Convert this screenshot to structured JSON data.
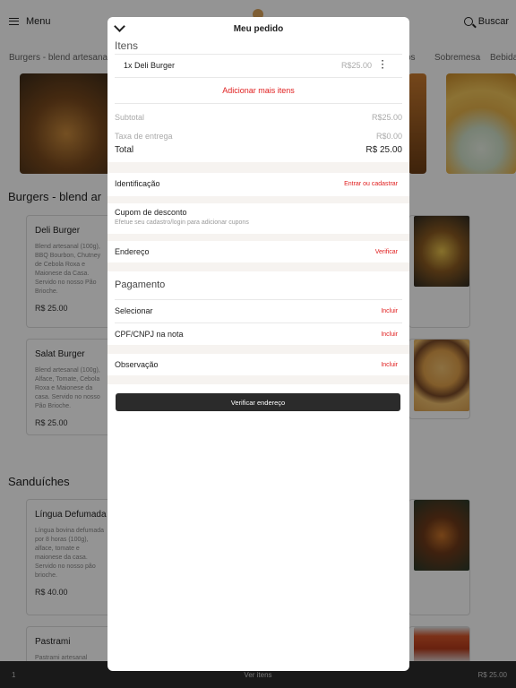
{
  "header": {
    "menu_label": "Menu",
    "search_label": "Buscar"
  },
  "categories": [
    "Burgers - blend artesanal",
    "os",
    "Sobremesa",
    "Bebida"
  ],
  "sections": [
    {
      "title": "Burgers - blend ar",
      "products": [
        {
          "name": "Deli Burger",
          "description": "Blend artesanal (100g), BBQ Bourbon, Chutney de Cebola Roxa e Maionese da Casa. Servido no nosso Pão Brioche.",
          "price": "R$ 25.00"
        },
        {
          "name": "Salat Burger",
          "description": "Blend artesanal (100g), Alface, Tomate, Cebola Roxa e Maionese da casa. Servido no nosso Pão Brioche.",
          "price": "R$ 25.00"
        }
      ]
    },
    {
      "title": "Sanduíches",
      "products": [
        {
          "name": "Língua Defumada",
          "description": "Língua bovina defumada por 8 horas (100g), alface, tomate e maionese da casa. Servido no nosso pão brioche.",
          "price": "R$ 40.00"
        },
        {
          "name": "Pastrami",
          "description": "Pastrami artesanal",
          "price": ""
        }
      ]
    }
  ],
  "bottom_bar": {
    "count": "1",
    "view_items": "Ver itens",
    "total": "R$ 25.00"
  },
  "modal": {
    "title": "Meu pedido",
    "items_heading": "Itens",
    "items": [
      {
        "name": "1x Deli Burger",
        "price": "R$25.00"
      }
    ],
    "add_more": "Adicionar mais itens",
    "subtotal_label": "Subtotal",
    "subtotal_value": "R$25.00",
    "delivery_label": "Taxa de entrega",
    "delivery_value": "R$0.00",
    "total_label": "Total",
    "total_value": "R$ 25.00",
    "identification": {
      "label": "Identificação",
      "action": "Entrar ou cadastrar"
    },
    "coupon": {
      "label": "Cupom de desconto",
      "hint": "Efetue seu cadastro/login para adicionar cupons"
    },
    "address": {
      "label": "Endereço",
      "action": "Verificar"
    },
    "payment_heading": "Pagamento",
    "payment_select": {
      "label": "Selecionar",
      "action": "Incluir"
    },
    "tax_id": {
      "label": "CPF/CNPJ na nota",
      "action": "Incluir"
    },
    "note": {
      "label": "Observação",
      "action": "Incluir"
    },
    "primary_button": "Verificar endereço"
  },
  "colors": {
    "accent": "#e02020",
    "dark": "#2b2b2b",
    "overlay": "rgba(0,0,0,0.42)"
  }
}
